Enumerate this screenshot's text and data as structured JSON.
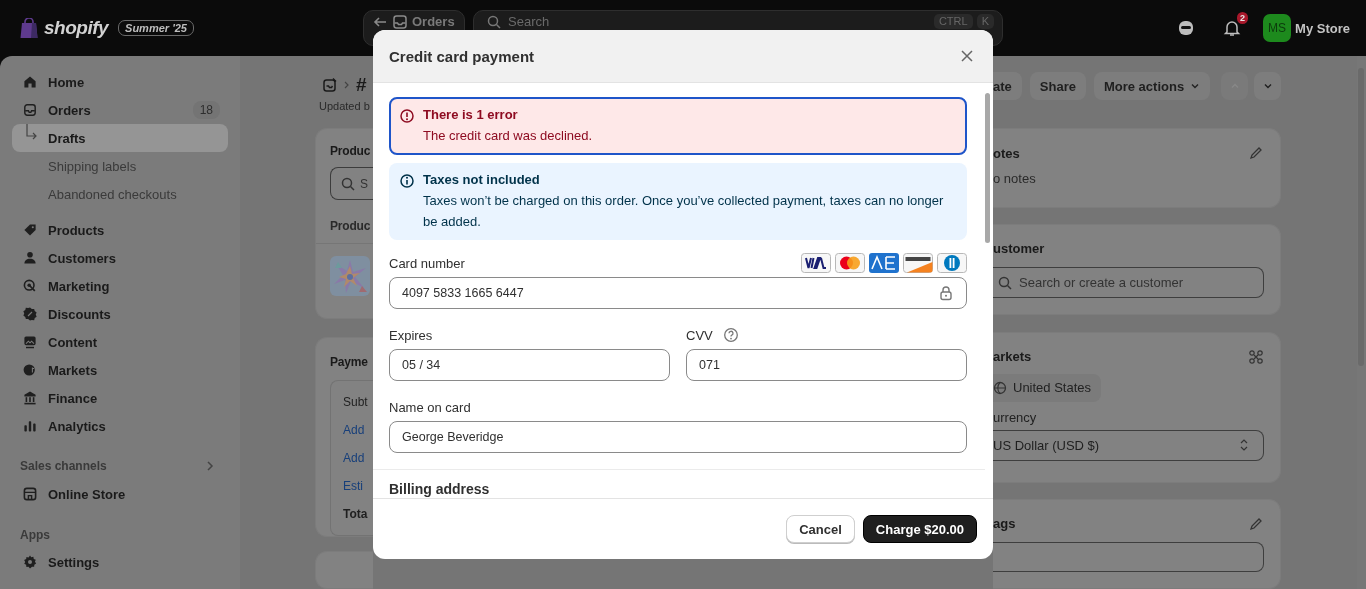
{
  "topbar": {
    "logo": "shopify",
    "edition": "Summer '25",
    "back_button": "Orders",
    "search": {
      "placeholder": "Search",
      "shortcut": [
        "CTRL",
        "K"
      ]
    },
    "notifications": "2",
    "avatar": "MS",
    "store": "My Store"
  },
  "sidebar": {
    "sections": [
      {
        "items": [
          {
            "label": "Home",
            "selected": false
          },
          {
            "label": "Orders",
            "badge": "18",
            "selected": false,
            "children": [
              {
                "label": "Drafts",
                "selected": true
              },
              {
                "label": "Shipping labels",
                "selected": false
              },
              {
                "label": "Abandoned checkouts",
                "selected": false
              }
            ]
          }
        ]
      },
      {
        "items": [
          {
            "label": "Products",
            "selected": false
          },
          {
            "label": "Customers",
            "selected": false
          },
          {
            "label": "Marketing",
            "selected": false
          },
          {
            "label": "Discounts",
            "selected": false
          },
          {
            "label": "Content",
            "selected": false
          },
          {
            "label": "Markets",
            "selected": false
          },
          {
            "label": "Finance",
            "selected": false
          },
          {
            "label": "Analytics",
            "selected": false
          }
        ]
      },
      {
        "heading": "Sales channels",
        "items": [
          {
            "label": "Online Store",
            "selected": false
          }
        ]
      },
      {
        "heading": "Apps"
      }
    ],
    "footer": {
      "label": "Settings",
      "selected": false
    }
  },
  "order": {
    "title": "#",
    "subtitle": "Updated b",
    "actions": [
      {
        "label": "ate",
        "menu": false
      },
      {
        "label": "Share",
        "menu": false
      },
      {
        "label": "More actions",
        "menu": true
      }
    ],
    "nav": [
      {
        "kind": "up",
        "disabled": true
      },
      {
        "kind": "down",
        "disabled": false
      }
    ]
  },
  "products_card": {
    "title": "Produc",
    "search_placeholder": "S",
    "column": "Produc"
  },
  "payment_card": {
    "title": "Payme",
    "rows": [
      {
        "label": "Subt",
        "kind": "text"
      },
      {
        "label": "Add",
        "kind": "link"
      },
      {
        "label": "Add",
        "kind": "link"
      },
      {
        "label": "Esti",
        "kind": "link"
      },
      {
        "label": "Tota",
        "kind": "total"
      }
    ]
  },
  "notes_card": {
    "title": "otes",
    "text": "o notes"
  },
  "customer_card": {
    "title": "ustomer",
    "search_placeholder": "Search or create a customer"
  },
  "markets_card": {
    "title": "arkets",
    "market": "United States",
    "currency_label": "urrency",
    "currency": "US Dollar (USD $)"
  },
  "tags_card": {
    "title": "ags"
  },
  "modal": {
    "title": "Credit card payment",
    "error": {
      "title": "There is 1 error",
      "message": "The credit card was declined."
    },
    "info": {
      "title": "Taxes not included",
      "message": "Taxes won’t be charged on this order. Once you’ve collected payment, taxes can no longer be added."
    },
    "card_number": {
      "label": "Card number",
      "value": "4097 5833 1665 6447"
    },
    "expires": {
      "label": "Expires",
      "value": "05 / 34"
    },
    "cvv": {
      "label": "CVV",
      "value": "071"
    },
    "name": {
      "label": "Name on card",
      "value": "George Beveridge"
    },
    "billing_heading": "Billing address",
    "buttons": [
      {
        "label": "Cancel",
        "kind": "secondary"
      },
      {
        "label": "Charge $20.00",
        "kind": "primary"
      }
    ]
  }
}
